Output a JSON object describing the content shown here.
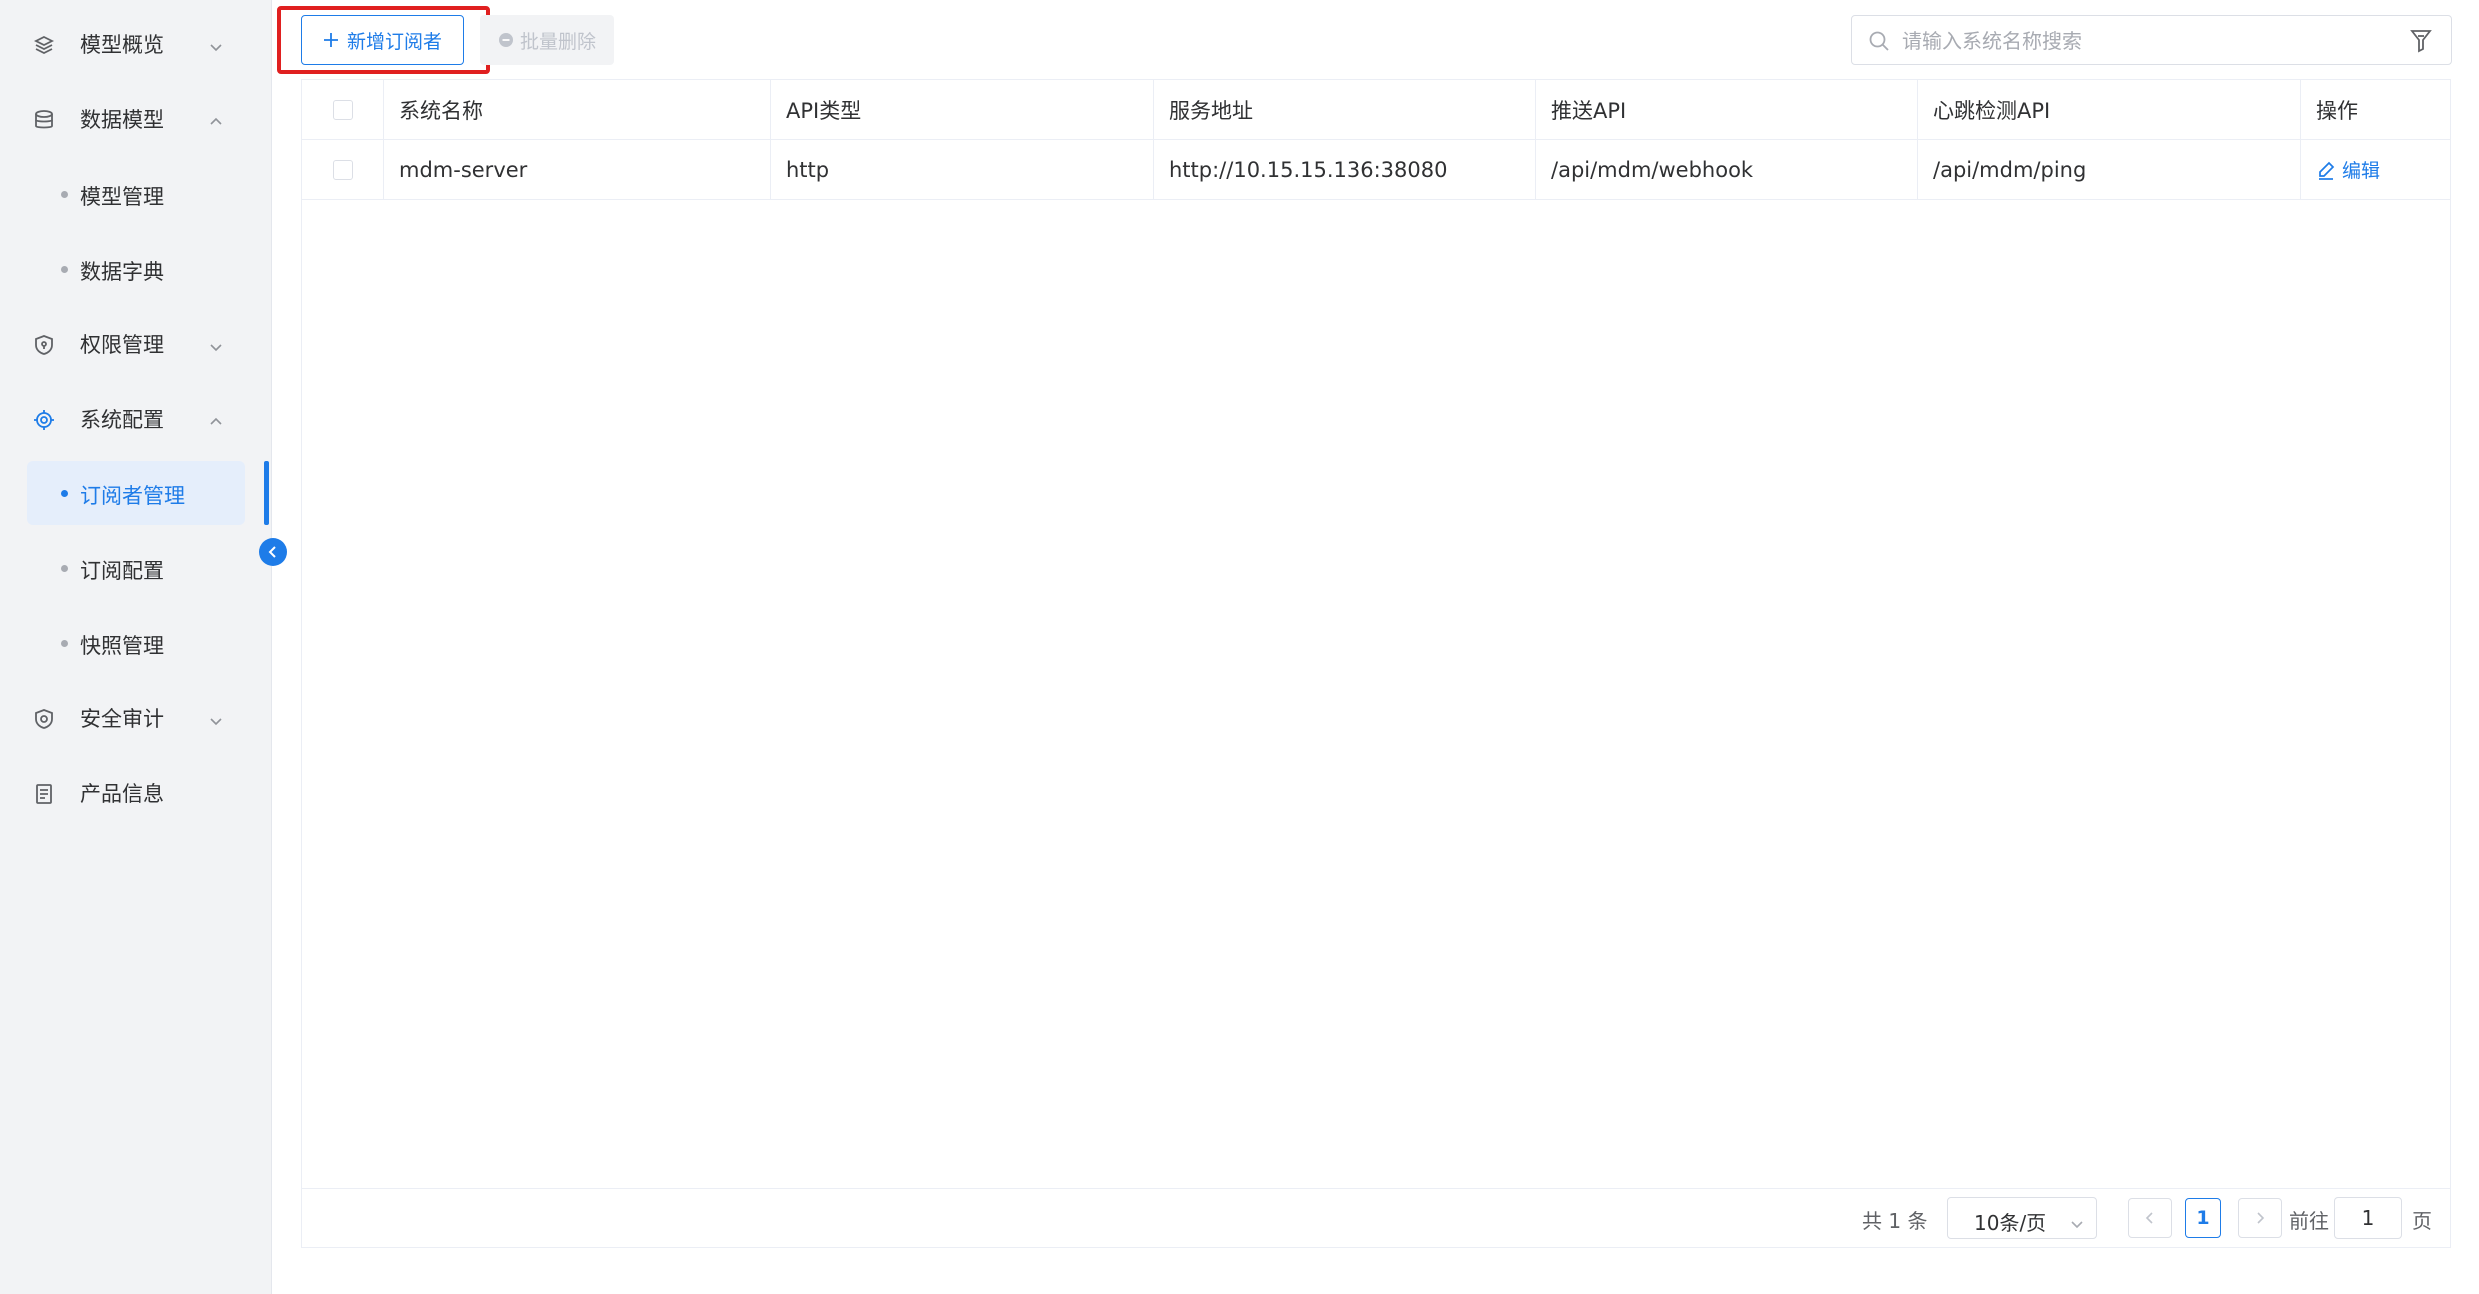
{
  "sidebar": {
    "items": [
      {
        "label": "模型概览",
        "icon": "layers-icon",
        "arrow": "down"
      },
      {
        "label": "数据模型",
        "icon": "database-icon",
        "arrow": "up"
      },
      {
        "label": "权限管理",
        "icon": "shield-icon",
        "arrow": "down"
      },
      {
        "label": "系统配置",
        "icon": "gear-icon",
        "arrow": "up"
      },
      {
        "label": "安全审计",
        "icon": "shield-check-icon",
        "arrow": "down"
      },
      {
        "label": "产品信息",
        "icon": "document-icon"
      }
    ],
    "data_model_children": [
      "模型管理",
      "数据字典"
    ],
    "system_config_children": [
      "订阅者管理",
      "订阅配置",
      "快照管理"
    ],
    "active_child": "订阅者管理"
  },
  "toolbar": {
    "add_label": "新增订阅者",
    "batch_delete_label": "批量删除"
  },
  "search": {
    "placeholder": "请输入系统名称搜索",
    "value": ""
  },
  "table": {
    "headers": [
      "系统名称",
      "API类型",
      "服务地址",
      "推送API",
      "心跳检测API",
      "操作"
    ],
    "rows": [
      {
        "name": "mdm-server",
        "api_type": "http",
        "service_url": "http://10.15.15.136:38080",
        "push_api": "/api/mdm/webhook",
        "heartbeat_api": "/api/mdm/ping",
        "action": "编辑"
      }
    ]
  },
  "pagination": {
    "total": "共 1 条",
    "page_size": "10条/页",
    "current_page": "1",
    "goto_label": "前往",
    "goto_value": "1",
    "page_suffix": "页"
  },
  "colors": {
    "accent": "#1e7ce8",
    "highlight": "#e02020",
    "sidebar_bg": "#f2f3f5"
  }
}
